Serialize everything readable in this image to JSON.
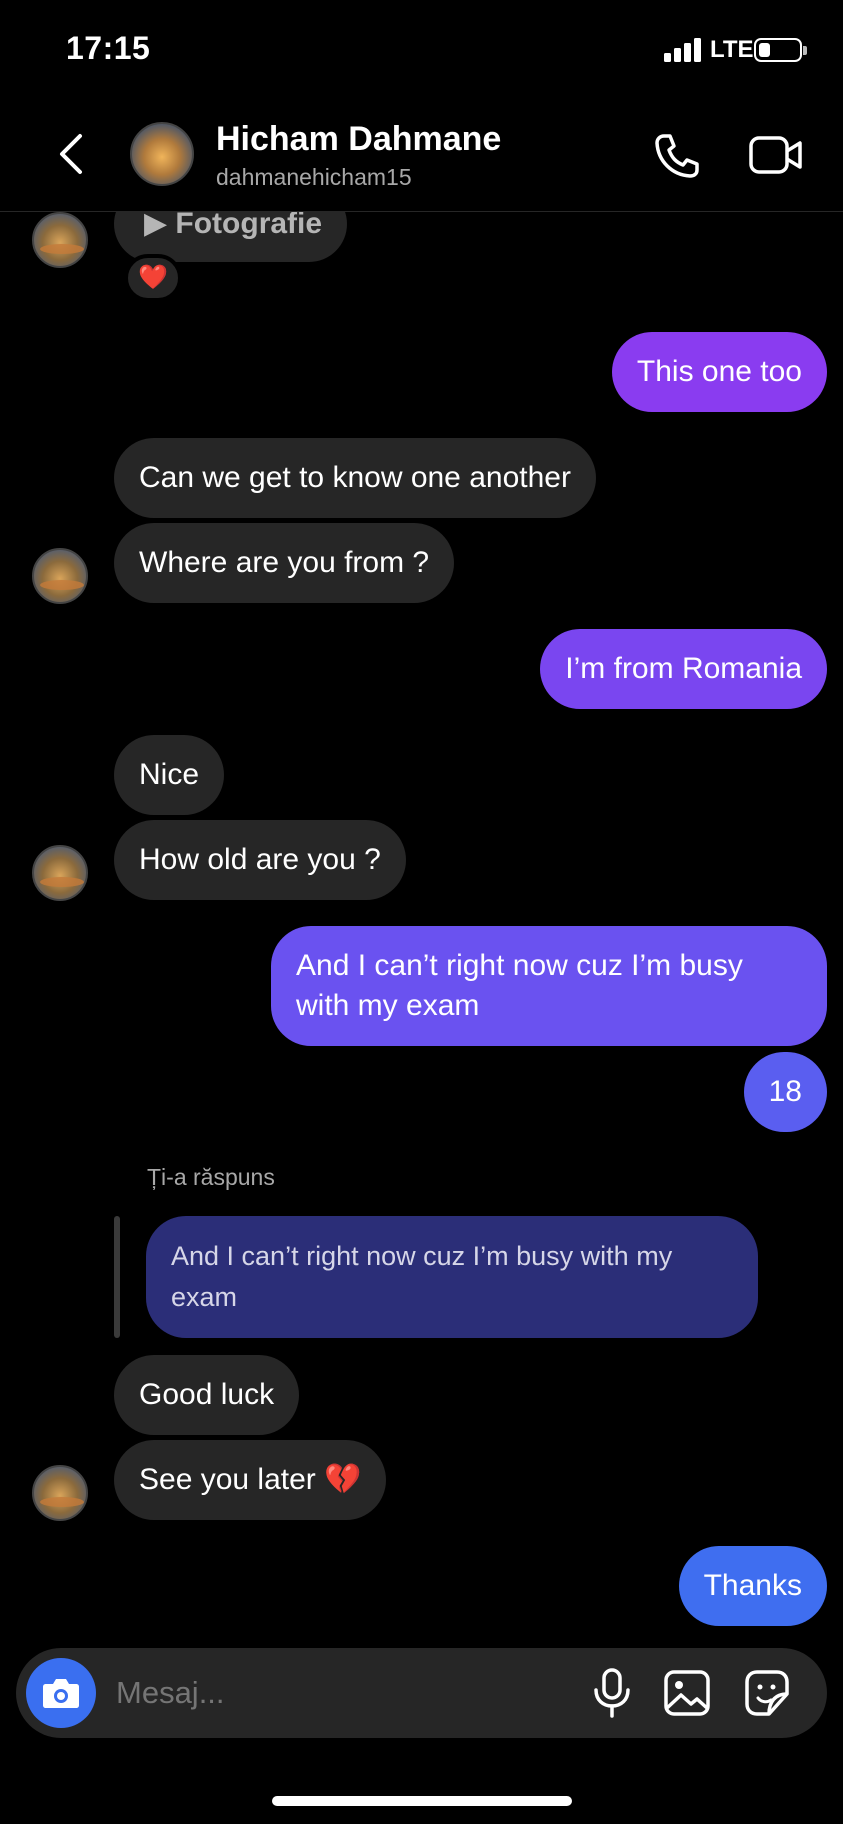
{
  "status_bar": {
    "time": "17:15",
    "network": "LTE",
    "battery_level": 0.2
  },
  "header": {
    "name": "Hicham Dahmane",
    "username": "dahmanehicham15",
    "icons": {
      "back": "chevron-left-icon",
      "call": "phone-icon",
      "video": "video-camera-icon"
    }
  },
  "messages": [
    {
      "from": "them",
      "text": "▶ Fotografie",
      "reaction": "❤️"
    },
    {
      "from": "me",
      "text": "This one too"
    },
    {
      "from": "them",
      "text": "Can we get to know one another"
    },
    {
      "from": "them",
      "text": "Where are you from ?"
    },
    {
      "from": "me",
      "text": "I’m from Romania"
    },
    {
      "from": "them",
      "text": "Nice"
    },
    {
      "from": "them",
      "text": "How old are you ?"
    },
    {
      "from": "me",
      "text": "And I can’t right now cuz I’m busy with my exam"
    },
    {
      "from": "me",
      "text": "18"
    },
    {
      "from": "them",
      "reply_label": "Ți-a răspuns",
      "quoted": "And I can’t right now cuz I’m busy with my exam"
    },
    {
      "from": "them",
      "text": "Good luck"
    },
    {
      "from": "them",
      "text": "See you later 💔"
    },
    {
      "from": "me",
      "text": "Thanks"
    }
  ],
  "composer": {
    "placeholder": "Mesaj...",
    "icons": [
      "camera-icon",
      "microphone-icon",
      "gallery-icon",
      "sticker-icon"
    ]
  },
  "colors": {
    "incoming_bubble": "#262626",
    "outgoing_top": "#8a3cf0",
    "outgoing_bottom": "#3f6ef0",
    "reply_quote": "#2b2e78"
  }
}
